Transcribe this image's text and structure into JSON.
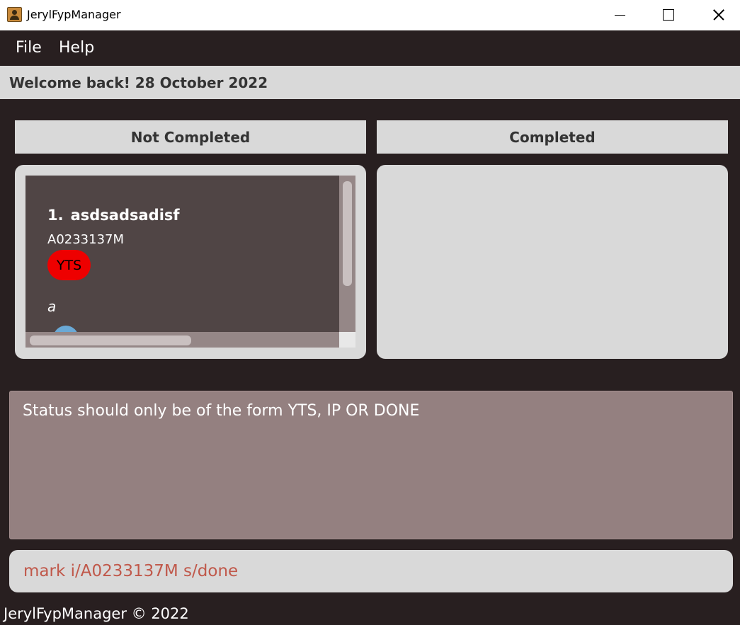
{
  "window": {
    "title": "JerylFypManager"
  },
  "menu": {
    "file": "File",
    "help": "Help"
  },
  "welcome": "Welcome back! 28 October 2022",
  "columns": {
    "not_completed": "Not Completed",
    "completed": "Completed"
  },
  "projects": [
    {
      "index": "1.",
      "name": "asdsadsadisf",
      "student_id": "A0233137M",
      "status": "YTS",
      "deadline": "a"
    }
  ],
  "result": "Status should only be of the form YTS, IP OR DONE",
  "command": {
    "value": "mark i/A0233137M s/done"
  },
  "footer": "JerylFypManager © 2022",
  "colors": {
    "background": "#281f20",
    "panel": "#d9d9d9",
    "list": "#504545",
    "status_yts": "#ee0000",
    "result_box": "#948080",
    "command_text": "#c0584a"
  }
}
